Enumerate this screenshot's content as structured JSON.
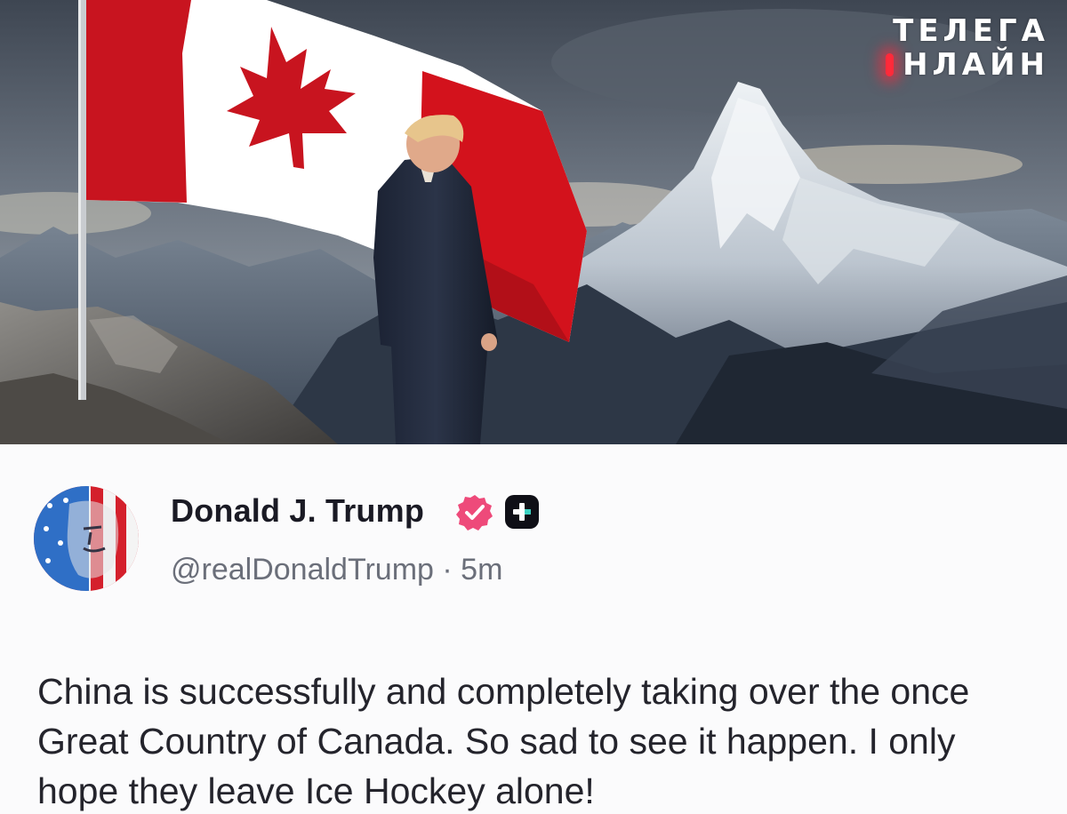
{
  "watermark": {
    "line1": "ТЕЛЕГА",
    "line2": "НЛАЙН"
  },
  "post": {
    "author_name": "Donald J. Trump",
    "handle": "@realDonaldTrump",
    "separator": "·",
    "time": "5m",
    "text": "China is successfully and completely taking over the once Great Country of Canada. So sad to see it happen. I only hope they leave Ice Hockey alone!"
  },
  "icons": {
    "verified": "verified-badge-icon",
    "plus_badge": "plus-badge-icon"
  },
  "colors": {
    "verified_badge": "#ee4a7a",
    "plus_badge_bg": "#0f0f16",
    "plus_badge_accent": "#3ad1c0",
    "name_text": "#1a1a24",
    "handle_text": "#6b6f7a",
    "watermark_accent": "#ff2a3a"
  }
}
